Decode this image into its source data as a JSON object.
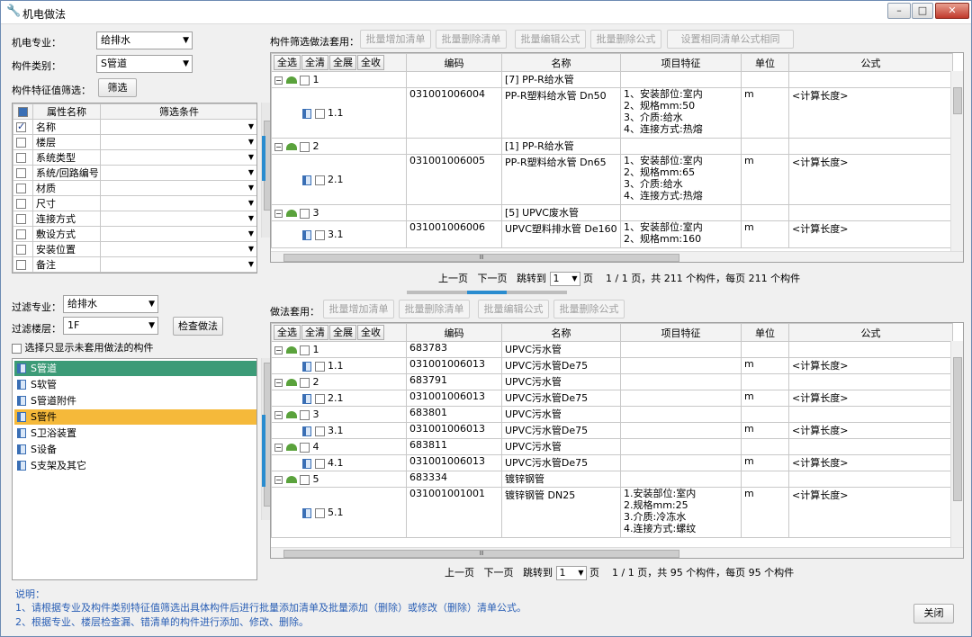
{
  "window": {
    "title": "机电做法",
    "minimize": "–",
    "maximize": "□",
    "close": "✕"
  },
  "left": {
    "major_label": "机电专业：",
    "major_value": "给排水",
    "category_label": "构件类别：",
    "category_value": "S管道",
    "filter_label": "构件特征值筛选：",
    "filter_button": "筛选",
    "attr_headers": [
      "属性名称",
      "筛选条件"
    ],
    "attrs": [
      {
        "name": "名称",
        "checked": true
      },
      {
        "name": "楼层",
        "checked": false
      },
      {
        "name": "系统类型",
        "checked": false
      },
      {
        "name": "系统/回路编号",
        "checked": false
      },
      {
        "name": "材质",
        "checked": false
      },
      {
        "name": "尺寸",
        "checked": false
      },
      {
        "name": "连接方式",
        "checked": false
      },
      {
        "name": "敷设方式",
        "checked": false
      },
      {
        "name": "安装位置",
        "checked": false
      },
      {
        "name": "备注",
        "checked": false
      }
    ],
    "filter_major_label": "过滤专业：",
    "filter_major_value": "给排水",
    "filter_floor_label": "过滤楼层：",
    "filter_floor_value": "1F",
    "check_button": "检查做法",
    "only_unused_label": "选择只显示未套用做法的构件",
    "tree": [
      "S管道",
      "S软管",
      "S管道附件",
      "S管件",
      "S卫浴装置",
      "S设备",
      "S支架及其它"
    ]
  },
  "top": {
    "label": "构件筛选做法套用：",
    "buttons": [
      "批量增加清单",
      "批量删除清单",
      "批量编辑公式",
      "批量删除公式",
      "设置相同清单公式相同"
    ],
    "mini": [
      "全选",
      "全清",
      "全展",
      "全收"
    ],
    "headers": [
      "编码",
      "名称",
      "项目特征",
      "单位",
      "公式"
    ],
    "rows": [
      {
        "kind": "grp",
        "idx": "1",
        "name": "[7] PP-R给水管"
      },
      {
        "kind": "item",
        "idx": "1.1",
        "code": "031001006004",
        "name": "PP-R塑料给水管 Dn50",
        "feat": [
          "1、安装部位:室内",
          "2、规格mm:50",
          "3、介质:给水",
          "4、连接方式:热熔"
        ],
        "unit": "m",
        "formula": "<计算长度>"
      },
      {
        "kind": "grp",
        "idx": "2",
        "name": "[1] PP-R给水管"
      },
      {
        "kind": "item",
        "idx": "2.1",
        "code": "031001006005",
        "name": "PP-R塑料给水管 Dn65",
        "feat": [
          "1、安装部位:室内",
          "2、规格mm:65",
          "3、介质:给水",
          "4、连接方式:热熔"
        ],
        "unit": "m",
        "formula": "<计算长度>"
      },
      {
        "kind": "grp",
        "idx": "3",
        "name": "[5] UPVC废水管"
      },
      {
        "kind": "item",
        "idx": "3.1",
        "code": "031001006006",
        "name": "UPVC塑料排水管 De160",
        "feat": [
          "1、安装部位:室内",
          "2、规格mm:160"
        ],
        "unit": "m",
        "formula": "<计算长度>"
      }
    ],
    "pager": {
      "prev": "上一页",
      "next": "下一页",
      "jump": "跳转到",
      "page": "1",
      "page_unit": "页",
      "summary": "1 / 1 页，共 211 个构件，每页 211 个构件"
    }
  },
  "bottom": {
    "label": "做法套用：",
    "buttons": [
      "批量增加清单",
      "批量删除清单",
      "批量编辑公式",
      "批量删除公式"
    ],
    "mini": [
      "全选",
      "全清",
      "全展",
      "全收"
    ],
    "headers": [
      "编码",
      "名称",
      "项目特征",
      "单位",
      "公式"
    ],
    "rows": [
      {
        "kind": "grp",
        "idx": "1",
        "code": "683783",
        "name": "UPVC污水管"
      },
      {
        "kind": "item",
        "idx": "1.1",
        "code": "031001006013",
        "name": "UPVC污水管De75",
        "unit": "m",
        "formula": "<计算长度>"
      },
      {
        "kind": "grp",
        "idx": "2",
        "code": "683791",
        "name": "UPVC污水管"
      },
      {
        "kind": "item",
        "idx": "2.1",
        "code": "031001006013",
        "name": "UPVC污水管De75",
        "unit": "m",
        "formula": "<计算长度>"
      },
      {
        "kind": "grp",
        "idx": "3",
        "code": "683801",
        "name": "UPVC污水管"
      },
      {
        "kind": "item",
        "idx": "3.1",
        "code": "031001006013",
        "name": "UPVC污水管De75",
        "unit": "m",
        "formula": "<计算长度>"
      },
      {
        "kind": "grp",
        "idx": "4",
        "code": "683811",
        "name": "UPVC污水管"
      },
      {
        "kind": "item",
        "idx": "4.1",
        "code": "031001006013",
        "name": "UPVC污水管De75",
        "unit": "m",
        "formula": "<计算长度>"
      },
      {
        "kind": "grp",
        "idx": "5",
        "code": "683334",
        "name": "镀锌钢管"
      },
      {
        "kind": "item",
        "idx": "5.1",
        "code": "031001001001",
        "name": "镀锌钢管 DN25",
        "feat": [
          "1.安装部位:室内",
          "2.规格mm:25",
          "3.介质:冷冻水",
          "4.连接方式:螺纹"
        ],
        "unit": "m",
        "formula": "<计算长度>"
      }
    ],
    "pager": {
      "prev": "上一页",
      "next": "下一页",
      "jump": "跳转到",
      "page": "1",
      "page_unit": "页",
      "summary": "1 / 1 页，共 95 个构件，每页 95 个构件"
    }
  },
  "notes": {
    "title": "说明：",
    "line1": "1、请根据专业及构件类别特征值筛选出具体构件后进行批量添加清单及批量添加（删除）或修改（删除）清单公式。",
    "line2": "2、根据专业、楼层检查漏、错清单的构件进行添加、修改、删除。"
  },
  "close_button": "关闭",
  "scroll_glyph": "Ⅲ"
}
